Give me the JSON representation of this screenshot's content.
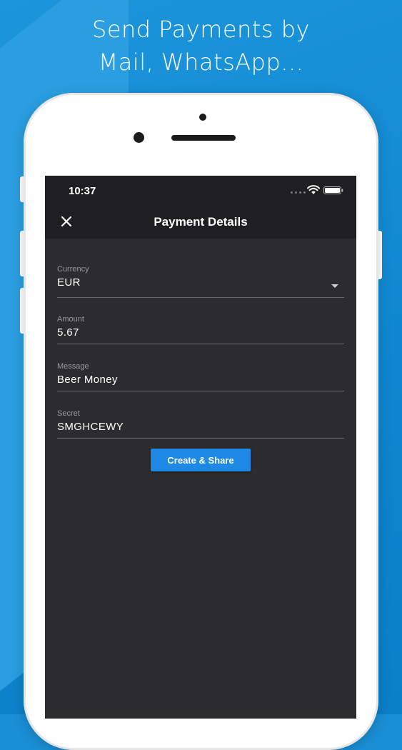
{
  "headline": {
    "line1": "Send Payments by",
    "line2": "Mail, WhatsApp..."
  },
  "status_bar": {
    "time": "10:37",
    "wifi_icon": "wifi-icon",
    "battery_icon": "battery-icon"
  },
  "app_bar": {
    "title": "Payment Details",
    "close_icon": "close-icon"
  },
  "form": {
    "currency": {
      "label": "Currency",
      "value": "EUR",
      "icon": "caret-down-icon"
    },
    "amount": {
      "label": "Amount",
      "value": "5.67"
    },
    "message": {
      "label": "Message",
      "value": "Beer Money"
    },
    "secret": {
      "label": "Secret",
      "value": "SMGHCEWY"
    }
  },
  "actions": {
    "create_share_label": "Create & Share"
  },
  "colors": {
    "background": "#1a8fd6",
    "screen": "#2c2c2e",
    "app_bar": "#1f1f21",
    "accent_button": "#1e88e5",
    "text_primary": "#ffffff",
    "text_label": "#9a9a9c"
  }
}
